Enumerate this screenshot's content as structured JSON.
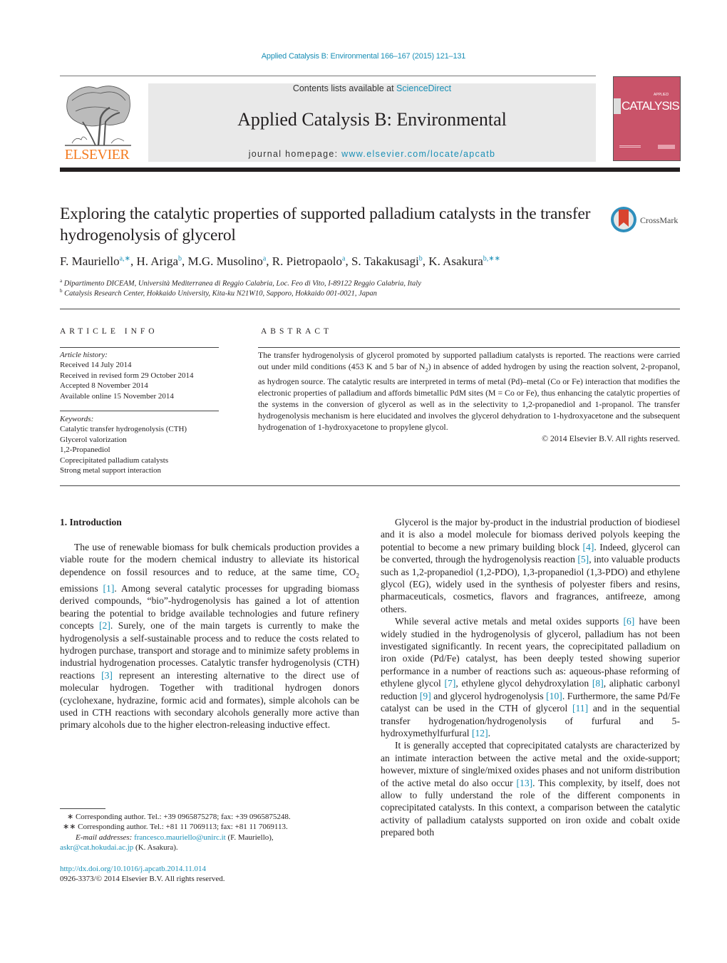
{
  "header": {
    "journal_reference": "Applied Catalysis B: Environmental 166–167 (2015) 121–131",
    "contents_prefix": "Contents lists available at ",
    "contents_link": "ScienceDirect",
    "journal_title": "Applied Catalysis B: Environmental",
    "homepage_prefix": "journal homepage: ",
    "homepage_link": "www.elsevier.com/locate/apcatb",
    "publisher_logo_text": "ELSEVIER",
    "cover_title": "CATALYSIS",
    "cover_subtitle": "APPLIED",
    "crossmark_label": "CrossMark"
  },
  "colors": {
    "link": "#1a8fb6",
    "elsevier_orange": "#f47b20",
    "cover": "#c95369",
    "masthead_bg": "#e9e9e9"
  },
  "article": {
    "title": "Exploring the catalytic properties of supported palladium catalysts in the transfer hydrogenolysis of glycerol",
    "authors": [
      {
        "name": "F. Mauriello",
        "sup": "a,∗"
      },
      {
        "name": "H. Ariga",
        "sup": "b"
      },
      {
        "name": "M.G. Musolino",
        "sup": "a"
      },
      {
        "name": "R. Pietropaolo",
        "sup": "a"
      },
      {
        "name": "S. Takakusagi",
        "sup": "b"
      },
      {
        "name": "K. Asakura",
        "sup": "b,∗∗"
      }
    ],
    "affiliations": [
      {
        "mark": "a",
        "text": "Dipartimento DICEAM, Università Mediterranea di Reggio Calabria, Loc. Feo di Vito, I-89122 Reggio Calabria, Italy"
      },
      {
        "mark": "b",
        "text": "Catalysis Research Center, Hokkaido University, Kita-ku N21W10, Sapporo, Hokkaido 001-0021, Japan"
      }
    ]
  },
  "article_info": {
    "heading": "ARTICLE INFO",
    "history_label": "Article history:",
    "history": [
      "Received 14 July 2014",
      "Received in revised form 29 October 2014",
      "Accepted 8 November 2014",
      "Available online 15 November 2014"
    ],
    "keywords_label": "Keywords:",
    "keywords": [
      "Catalytic transfer hydrogenolysis (CTH)",
      "Glycerol valorization",
      "1,2-Propanediol",
      "Coprecipitated palladium catalysts",
      "Strong metal support interaction"
    ]
  },
  "abstract": {
    "heading": "ABSTRACT",
    "part1": "The transfer hydrogenolysis of glycerol promoted by supported palladium catalysts is reported. The reactions were carried out under mild conditions (453 K and 5 bar of N",
    "sub1": "2",
    "part2": ") in absence of added hydrogen by using the reaction solvent, 2-propanol, as hydrogen source. The catalytic results are interpreted in terms of metal (Pd)–metal (Co or Fe) interaction that modifies the electronic properties of palladium and affords bimetallic PdM sites (M = Co or Fe), thus enhancing the catalytic properties of the systems in the conversion of glycerol as well as in the selectivity to 1,2-propanediol and 1-propanol. The transfer hydrogenolysis mechanism is here elucidated and involves the glycerol dehydration to 1-hydroxyacetone and the subsequent hydrogenation of 1-hydroxyacetone to propylene glycol.",
    "copyright": "© 2014 Elsevier B.V. All rights reserved."
  },
  "intro": {
    "heading": "1.  Introduction",
    "p1": [
      "The use of renewable biomass for bulk chemicals production provides a viable route for the modern chemical industry to alleviate its historical dependence on fossil resources and to reduce, at the same time, CO",
      "2",
      " emissions ",
      "[1]",
      ". Among several catalytic processes for upgrading biomass derived compounds, “bio”-hydrogenolysis has gained a lot of attention bearing the potential to bridge available technologies and future refinery concepts ",
      "[2]",
      ". Surely, one of the main targets is currently to make the hydrogenolysis a self-sustainable process and to reduce the costs related to hydrogen purchase, transport and storage and to minimize safety problems in industrial hydrogenation processes. Catalytic transfer hydrogenolysis (CTH) reactions ",
      "[3]",
      " represent an interesting alternative to the direct use of molecular hydrogen. Together with traditional hydrogen donors (cyclohexane, hydrazine, formic acid and formates), simple alcohols can be used in CTH reactions with secondary alcohols generally more active than primary alcohols due to the higher electron-releasing inductive effect."
    ],
    "p2": [
      "Glycerol is the major by-product in the industrial production of biodiesel and it is also a model molecule for biomass derived polyols keeping the potential to become a new primary building block ",
      "[4]",
      ". Indeed, glycerol can be converted, through the hydrogenolysis reaction ",
      "[5]",
      ", into valuable products such as 1,2-propanediol (1,2-PDO), 1,3-propanediol (1,3-PDO) and ethylene glycol (EG), widely used in the synthesis of polyester fibers and resins, pharmaceuticals, cosmetics, flavors and fragrances, antifreeze, among others."
    ],
    "p3": [
      "While several active metals and metal oxides supports ",
      "[6]",
      " have been widely studied in the hydrogenolysis of glycerol, palladium has not been investigated significantly. In recent years, the coprecipitated palladium on iron oxide (Pd/Fe) catalyst, has been deeply tested showing superior performance in a number of reactions such as: aqueous-phase reforming of ethylene glycol ",
      "[7]",
      ", ethylene glycol dehydroxylation ",
      "[8]",
      ", aliphatic carbonyl reduction ",
      "[9]",
      " and glycerol hydrogenolysis ",
      "[10]",
      ". Furthermore, the same Pd/Fe catalyst can be used in the CTH of glycerol ",
      "[11]",
      " and in the sequential transfer hydrogenation/hydrogenolysis of furfural and 5-hydroxymethylfurfural ",
      "[12]",
      "."
    ],
    "p4": [
      "It is generally accepted that coprecipitated catalysts are characterized by an intimate interaction between the active metal and the oxide-support; however, mixture of single/mixed oxides phases and not uniform distribution of the active metal do also occur ",
      "[13]",
      ". This complexity, by itself, does not allow to fully understand the role of the different components in coprecipitated catalysts. In this context, a comparison between the catalytic activity of palladium catalysts supported on iron oxide and cobalt oxide prepared both"
    ]
  },
  "footnotes": {
    "fn1": "∗  Corresponding author. Tel.: +39 0965875278; fax: +39 0965875248.",
    "fn2": "∗∗  Corresponding author. Tel.: +81 11 7069113; fax: +81 11 7069113.",
    "email_label": "E-mail addresses:",
    "email1": "francesco.mauriello@unirc.it",
    "email1_owner": " (F. Mauriello),",
    "email2": "askr@cat.hokudai.ac.jp",
    "email2_owner": " (K. Asakura).",
    "doi": "http://dx.doi.org/10.1016/j.apcatb.2014.11.014",
    "issn": "0926-3373/© 2014 Elsevier B.V. All rights reserved."
  }
}
